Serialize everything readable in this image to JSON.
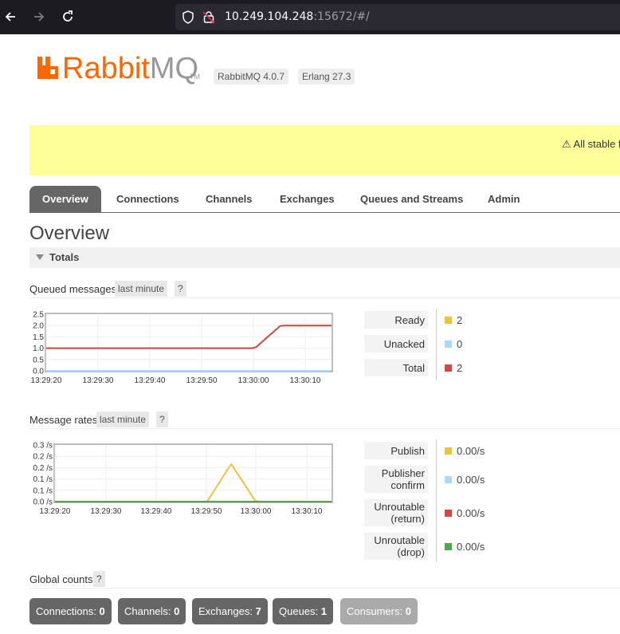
{
  "browser": {
    "url_host": "10.249.104.248",
    "url_rest": ":15672/#/"
  },
  "header": {
    "logo_rabbit": "Rabbit",
    "logo_mq": "MQ",
    "logo_tm": "TM",
    "version": "RabbitMQ 4.0.7",
    "erlang": "Erlang 27.3"
  },
  "banner": {
    "text": "⚠ All stable f"
  },
  "tabs": [
    {
      "label": "Overview",
      "active": true
    },
    {
      "label": "Connections"
    },
    {
      "label": "Channels"
    },
    {
      "label": "Exchanges"
    },
    {
      "label": "Queues and Streams"
    },
    {
      "label": "Admin"
    }
  ],
  "page_title": "Overview",
  "totals_label": "Totals",
  "queued": {
    "title": "Queued messages",
    "range": "last minute",
    "help": "?",
    "legend": [
      {
        "label": "Ready",
        "value": "2",
        "color": "#edc240"
      },
      {
        "label": "Unacked",
        "value": "0",
        "color": "#afd8f8"
      },
      {
        "label": "Total",
        "value": "2",
        "color": "#cb4b4b"
      }
    ]
  },
  "rates": {
    "title": "Message rates",
    "range": "last minute",
    "help": "?",
    "legend": [
      {
        "label": "Publish",
        "value": "0.00/s",
        "color": "#edc240"
      },
      {
        "label": "Publisher confirm",
        "value": "0.00/s",
        "color": "#afd8f8"
      },
      {
        "label": "Unroutable (return)",
        "value": "0.00/s",
        "color": "#cb4b4b"
      },
      {
        "label": "Unroutable (drop)",
        "value": "0.00/s",
        "color": "#4da74d"
      }
    ]
  },
  "global": {
    "title": "Global counts",
    "help": "?",
    "counts": [
      {
        "label": "Connections:",
        "value": "0"
      },
      {
        "label": "Channels:",
        "value": "0"
      },
      {
        "label": "Exchanges:",
        "value": "7"
      },
      {
        "label": "Queues:",
        "value": "1"
      },
      {
        "label": "Consumers:",
        "value": "0",
        "disabled": true
      }
    ]
  },
  "chart_data": [
    {
      "type": "line",
      "x_ticks": [
        "13:29:20",
        "13:29:30",
        "13:29:40",
        "13:29:50",
        "13:30:00",
        "13:30:10"
      ],
      "y_ticks": [
        "0.0",
        "0.5",
        "1.0",
        "1.5",
        "2.0",
        "2.5"
      ],
      "ylim": [
        0,
        2.5
      ],
      "x": [
        0,
        5,
        10,
        15,
        20,
        25,
        30,
        35,
        40,
        45,
        50,
        55
      ],
      "series": [
        {
          "name": "Total",
          "color": "#cb4b4b",
          "values": [
            1,
            1,
            1,
            1,
            1,
            1,
            1,
            1,
            1,
            1,
            1,
            2,
            2,
            2,
            2
          ]
        },
        {
          "name": "Ready",
          "color": "#edc240",
          "values": [
            1,
            1,
            1,
            1,
            1,
            1,
            1,
            1,
            1,
            1,
            1,
            2,
            2,
            2,
            2
          ]
        },
        {
          "name": "Unacked",
          "color": "#afd8f8",
          "values": [
            0,
            0,
            0,
            0,
            0,
            0,
            0,
            0,
            0,
            0,
            0,
            0,
            0,
            0,
            0
          ]
        }
      ]
    },
    {
      "type": "line",
      "x_ticks": [
        "13:29:20",
        "13:29:30",
        "13:29:40",
        "13:29:50",
        "13:30:00",
        "13:30:10"
      ],
      "y_ticks": [
        "0.0 /s",
        "0.1 /s",
        "0.1 /s",
        "0.2 /s",
        "0.2 /s",
        "0.3 /s"
      ],
      "ylim": [
        0,
        0.3
      ],
      "series": [
        {
          "name": "Publish",
          "color": "#edc240",
          "values": [
            0,
            0,
            0,
            0,
            0,
            0,
            0,
            0,
            0,
            0,
            0.2,
            0,
            0,
            0,
            0,
            0
          ]
        },
        {
          "name": "Unroutable (drop)",
          "color": "#4da74d",
          "values": [
            0,
            0,
            0,
            0,
            0,
            0,
            0,
            0,
            0,
            0,
            0,
            0,
            0,
            0,
            0,
            0
          ]
        }
      ]
    }
  ]
}
